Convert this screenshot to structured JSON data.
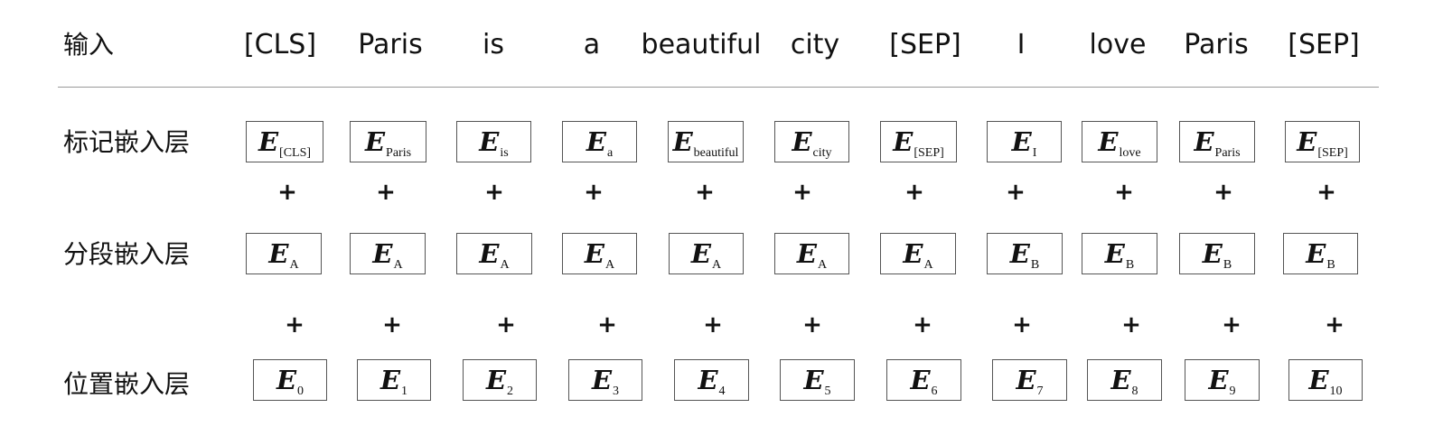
{
  "rows": {
    "input_label": "输入",
    "token_label": "标记嵌入层",
    "segment_label": "分段嵌入层",
    "position_label": "位置嵌入层"
  },
  "tokens": [
    "[CLS]",
    "Paris",
    "is",
    "a",
    "beautiful",
    "city",
    "[SEP]",
    "I",
    "love",
    "Paris",
    "[SEP]"
  ],
  "embedding_symbol": "E",
  "plus_symbol": "+",
  "token_embeddings": [
    "[CLS]",
    "Paris",
    "is",
    "a",
    "beautiful",
    "city",
    "[SEP]",
    "I",
    "love",
    "Paris",
    "[SEP]"
  ],
  "segment_embeddings": [
    "A",
    "A",
    "A",
    "A",
    "A",
    "A",
    "A",
    "B",
    "B",
    "B",
    "B"
  ],
  "position_embeddings": [
    "0",
    "1",
    "2",
    "3",
    "4",
    "5",
    "6",
    "7",
    "8",
    "9",
    "10"
  ]
}
